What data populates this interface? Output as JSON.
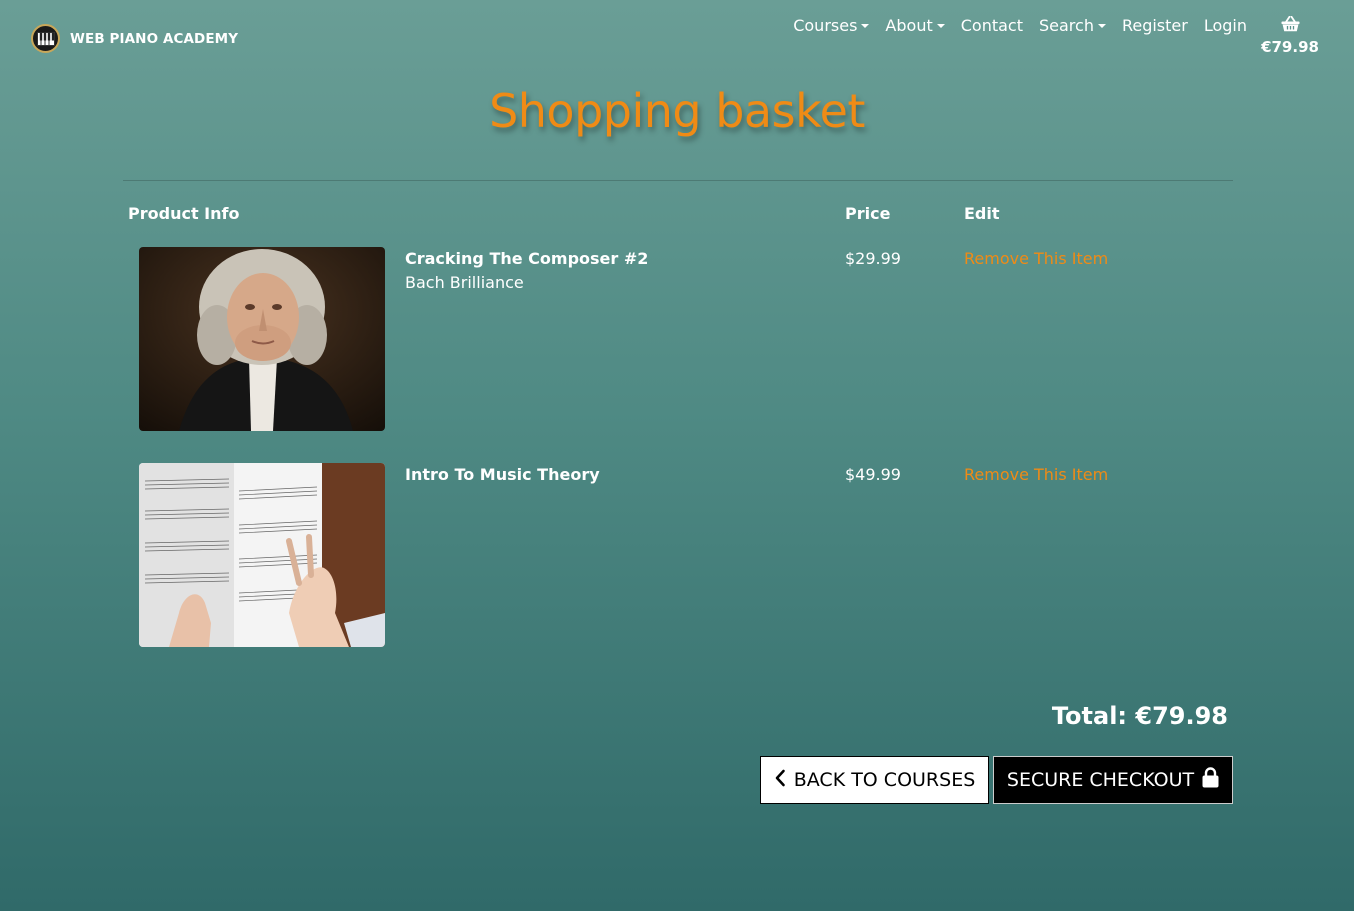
{
  "nav": {
    "brand": "WEB PIANO ACADEMY",
    "links": [
      {
        "label": "Courses",
        "dropdown": true
      },
      {
        "label": "About",
        "dropdown": true
      },
      {
        "label": "Contact",
        "dropdown": false
      },
      {
        "label": "Search",
        "dropdown": true
      },
      {
        "label": "Register",
        "dropdown": false
      },
      {
        "label": "Login",
        "dropdown": false
      }
    ],
    "basket_total": "€79.98"
  },
  "page": {
    "title": "Shopping basket"
  },
  "table": {
    "headers": {
      "product": "Product Info",
      "price": "Price",
      "edit": "Edit"
    },
    "items": [
      {
        "title": "Cracking The Composer #2",
        "subtitle": "Bach Brilliance",
        "price": "$29.99",
        "remove_label": "Remove This Item"
      },
      {
        "title": "Intro To Music Theory",
        "subtitle": "",
        "price": "$49.99",
        "remove_label": "Remove This Item"
      }
    ]
  },
  "summary": {
    "total": "Total: €79.98",
    "back_label": "BACK TO COURSES",
    "checkout_label": "SECURE CHECKOUT"
  },
  "colors": {
    "accent": "#ef8b16",
    "background_top": "#6a9e96",
    "background_bottom": "#306a69"
  },
  "icons": {
    "brand": "piano-keys-icon",
    "basket": "shopping-basket-icon",
    "back": "chevron-left-icon",
    "checkout": "lock-icon"
  }
}
